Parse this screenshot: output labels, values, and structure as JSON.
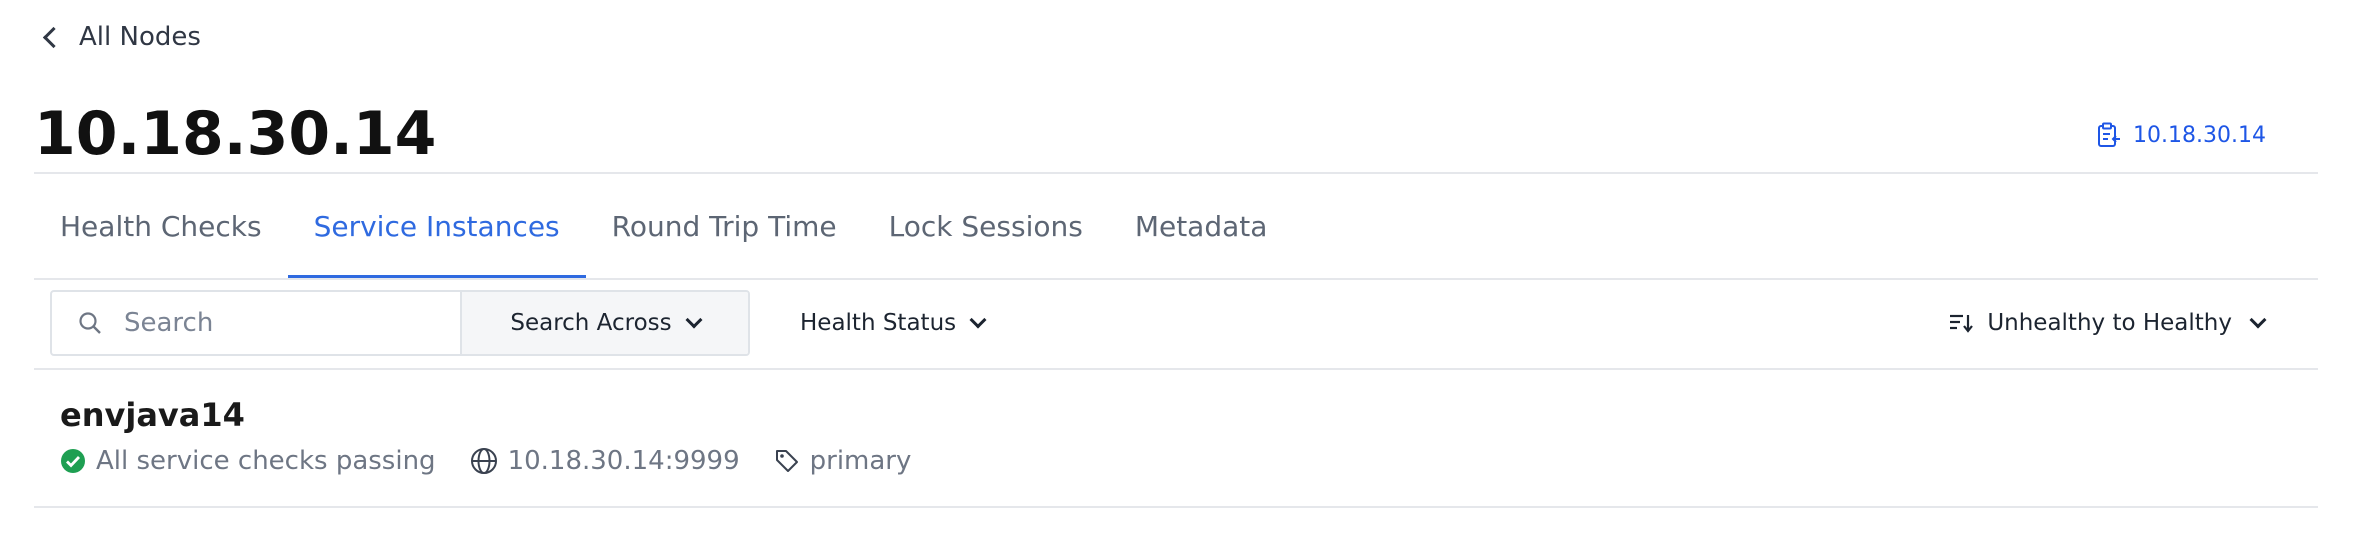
{
  "nav": {
    "back_label": "All Nodes"
  },
  "page": {
    "title": "10.18.30.14",
    "copy_address": "10.18.30.14"
  },
  "tabs": [
    {
      "label": "Health Checks",
      "active": false
    },
    {
      "label": "Service Instances",
      "active": true
    },
    {
      "label": "Round Trip Time",
      "active": false
    },
    {
      "label": "Lock Sessions",
      "active": false
    },
    {
      "label": "Metadata",
      "active": false
    }
  ],
  "toolbar": {
    "search_placeholder": "Search",
    "search_across_label": "Search Across",
    "health_status_label": "Health Status",
    "sort_label": "Unhealthy to Healthy"
  },
  "instances": [
    {
      "name": "envjava14",
      "status_text": "All service checks passing",
      "address": "10.18.30.14:9999",
      "tag": "primary"
    }
  ],
  "colors": {
    "accent": "#2f6ae0",
    "link": "#1e56e6",
    "passing": "#1e9f52",
    "divider": "#e5e7eb"
  }
}
